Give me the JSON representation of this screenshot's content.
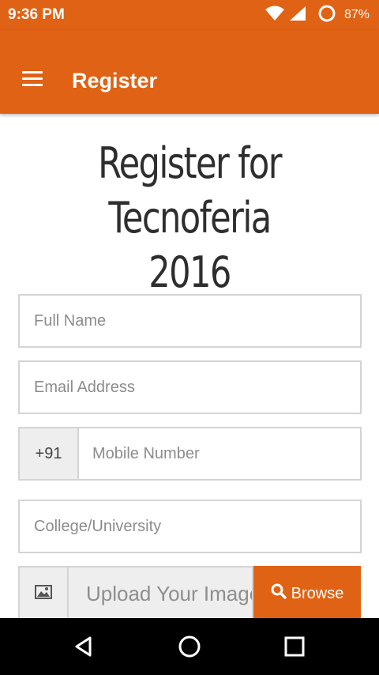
{
  "status_bar": {
    "time": "9:36 PM",
    "battery": "87%"
  },
  "app_bar": {
    "title": "Register"
  },
  "heading": {
    "line1": "Register for",
    "line2": "Tecnoferia 2016"
  },
  "form": {
    "full_name_placeholder": "Full Name",
    "email_placeholder": "Email Address",
    "phone_prefix": "+91",
    "mobile_placeholder": "Mobile Number",
    "college_placeholder": "College/University",
    "upload_placeholder": "Upload Your Image",
    "browse_label": "Browse"
  },
  "colors": {
    "primary": "#e06214",
    "navbar": "#000000"
  },
  "icons": [
    "menu-icon",
    "wifi-icon",
    "signal-icon",
    "battery-icon",
    "image-icon",
    "search-icon",
    "back-icon",
    "home-icon",
    "recents-icon"
  ]
}
